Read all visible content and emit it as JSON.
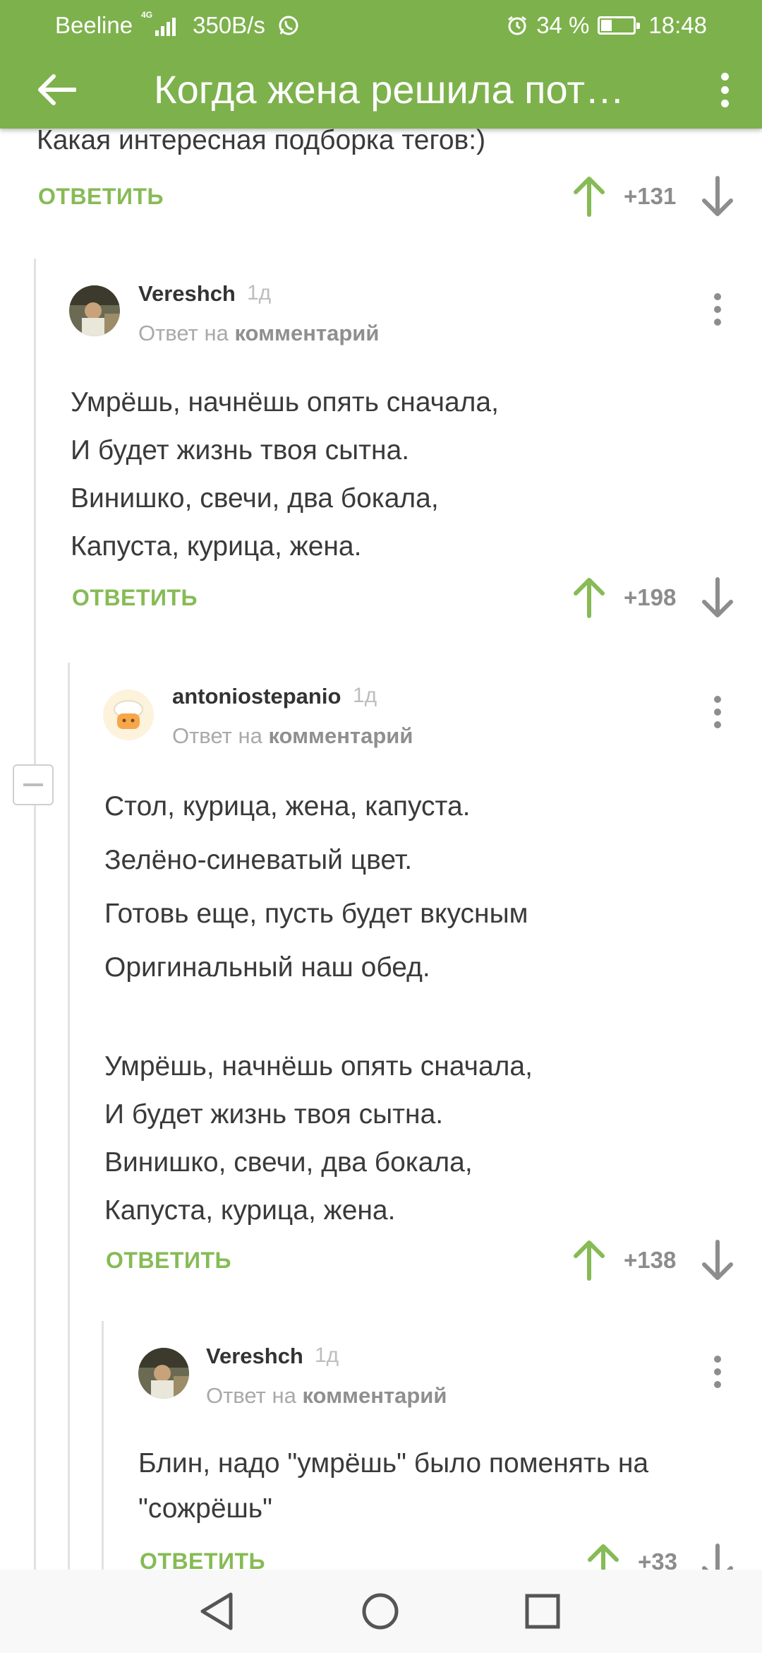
{
  "status_bar": {
    "carrier": "Beeline",
    "network_gen": "4G",
    "speed": "350B/s",
    "battery_percent": "34 %",
    "battery_level": 0.34,
    "time": "18:48"
  },
  "app_bar": {
    "title": "Когда жена решила пот…"
  },
  "comments": [
    {
      "text": "Какая интересная подборка тегов:)",
      "reply_label": "ОТВЕТИТЬ",
      "score": "+131"
    },
    {
      "username": "Vereshch",
      "time": "1д",
      "reply_prefix": "Ответ на",
      "reply_target": "комментарий",
      "lines": [
        "Умрёшь, начнёшь опять сначала,",
        "И будет жизнь твоя сытна.",
        "Винишко, свечи, два бокала,",
        "Капуста, курица, жена."
      ],
      "reply_label": "ОТВЕТИТЬ",
      "score": "+198"
    },
    {
      "username": "antoniostepanio",
      "time": "1д",
      "reply_prefix": "Ответ на",
      "reply_target": "комментарий",
      "lines": [
        "Стол, курица, жена, капуста.",
        "Зелёно-синеватый цвет.",
        "Готовь еще, пусть будет вкусным",
        "Оригинальный наш обед.",
        "",
        "Умрёшь, начнёшь опять сначала,",
        "И будет жизнь твоя сытна.",
        "Винишко, свечи, два бокала,",
        "Капуста, курица, жена."
      ],
      "reply_label": "ОТВЕТИТЬ",
      "score": "+138"
    },
    {
      "username": "Vereshch",
      "time": "1д",
      "reply_prefix": "Ответ на",
      "reply_target": "комментарий",
      "lines": [
        "Блин, надо \"умрёшь\" было поменять на",
        "\"сожрёшь\""
      ],
      "reply_label": "ОТВЕТИТЬ",
      "score": "+33"
    }
  ],
  "colors": {
    "brand": "#7db14c",
    "upvote": "#86bb55",
    "downvote": "#8d8d8d"
  }
}
